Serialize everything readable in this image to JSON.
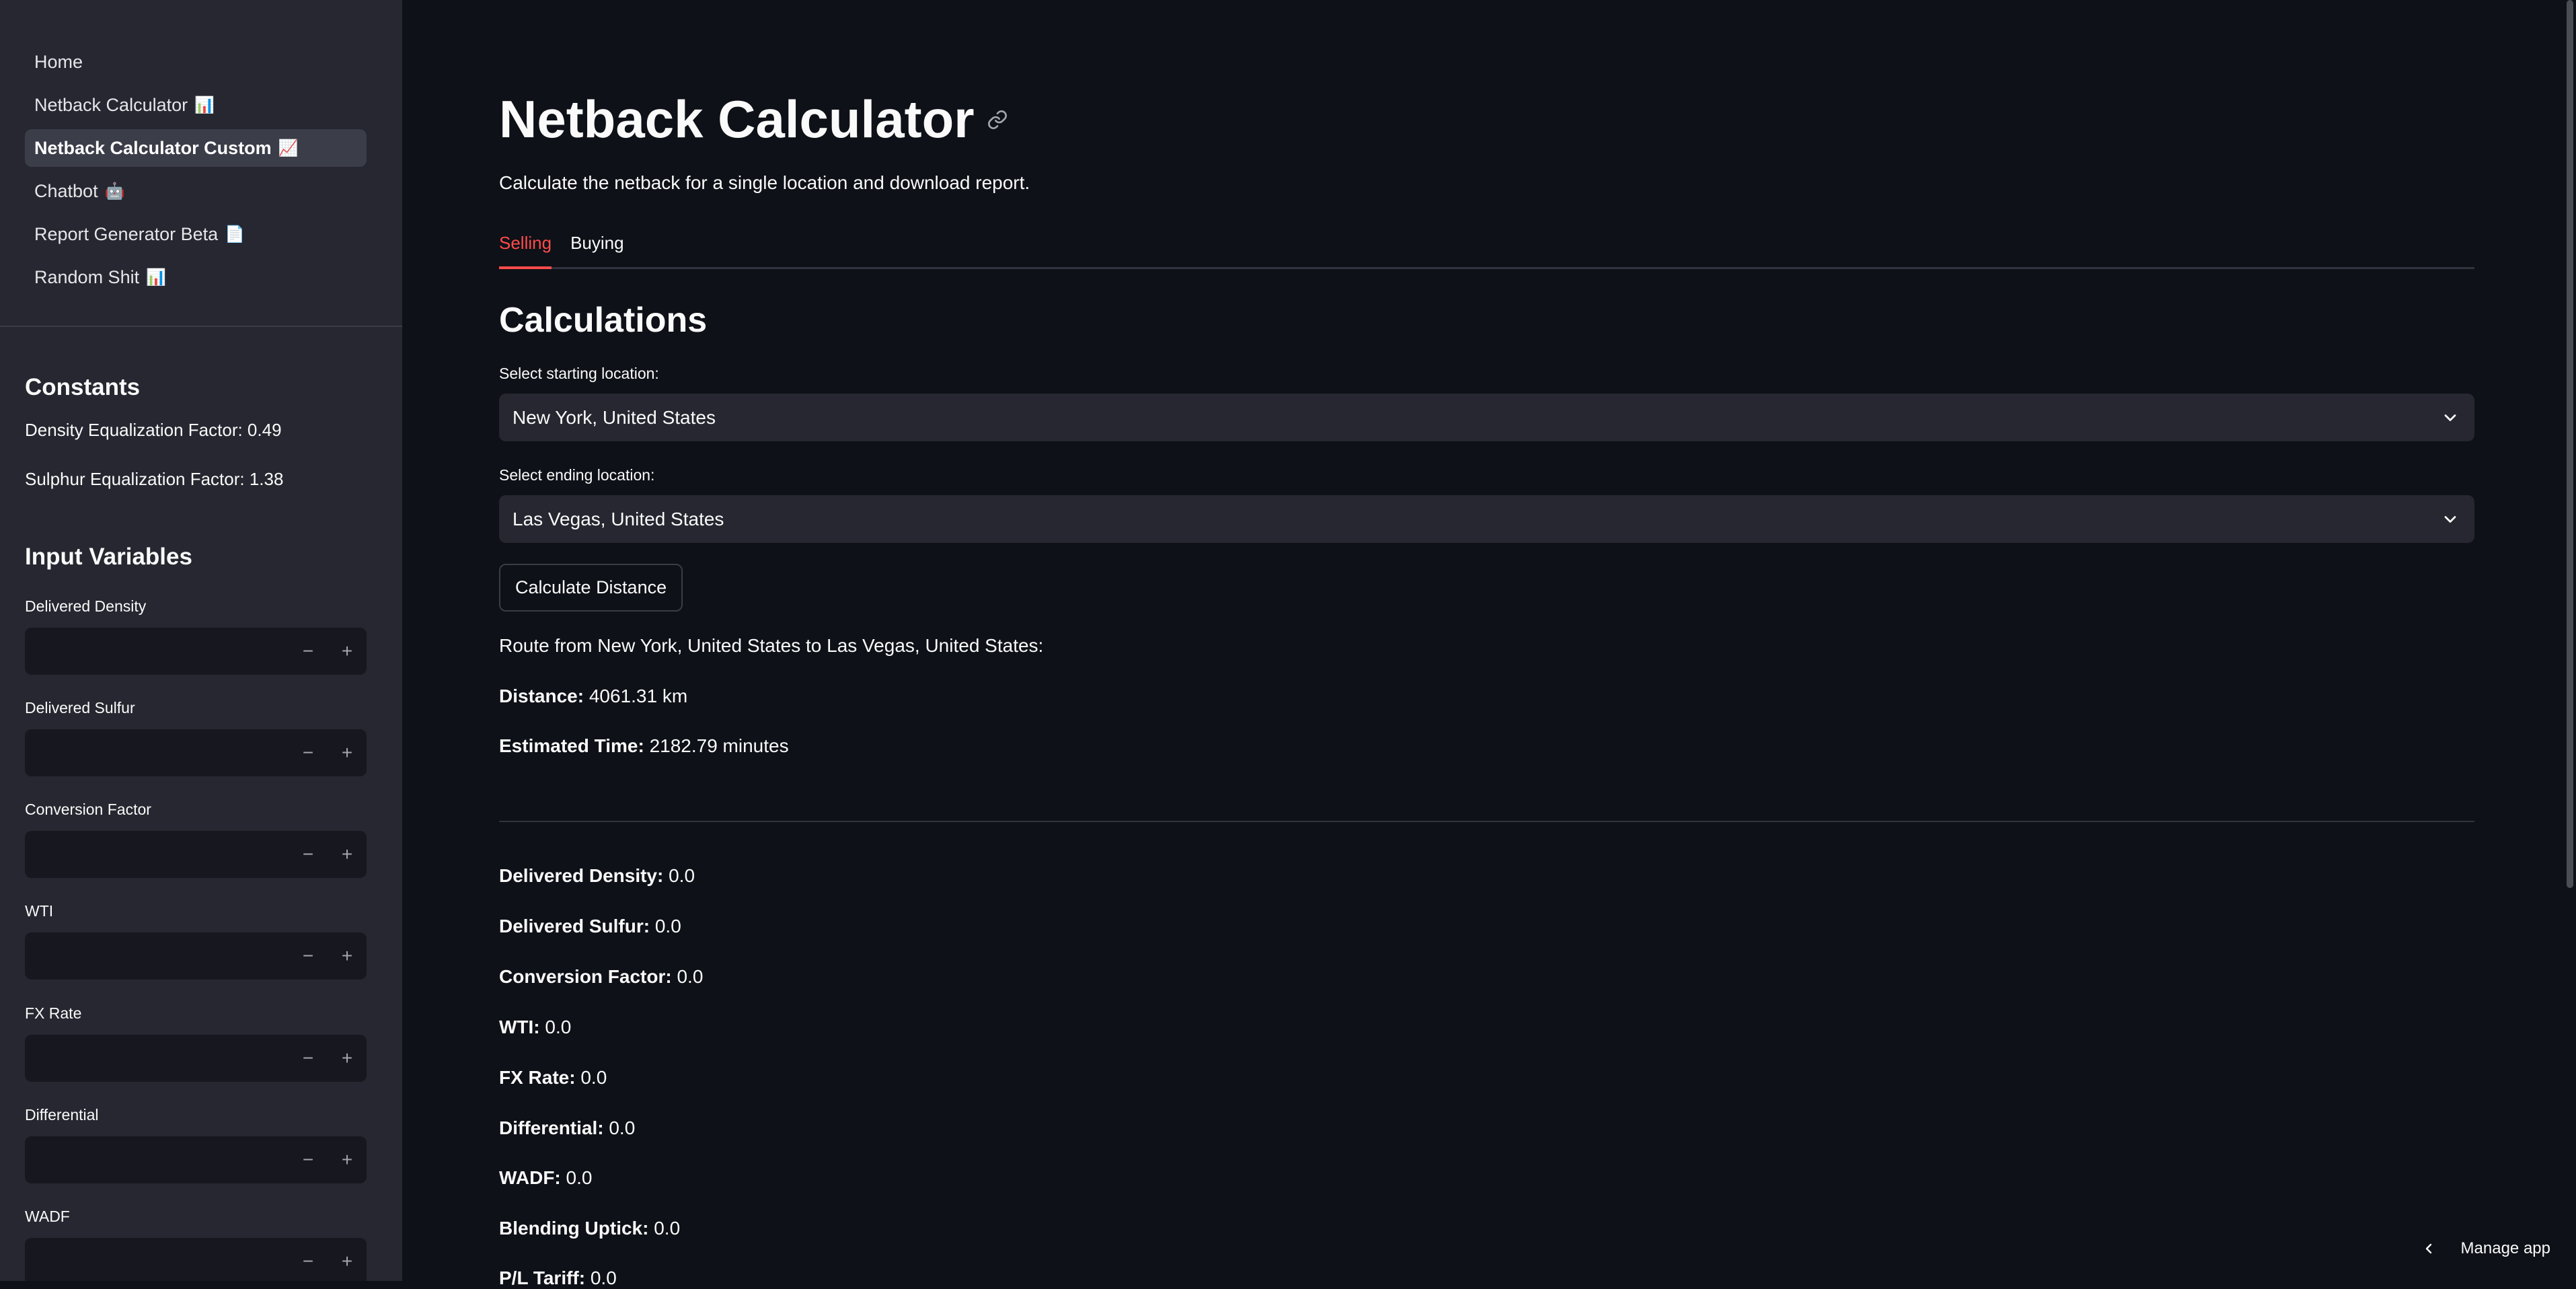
{
  "nav": {
    "items": [
      {
        "label": "Home",
        "emoji": ""
      },
      {
        "label": "Netback Calculator",
        "emoji": "📊"
      },
      {
        "label": "Netback Calculator Custom",
        "emoji": "📈"
      },
      {
        "label": "Chatbot",
        "emoji": "🤖"
      },
      {
        "label": "Report Generator Beta",
        "emoji": "📄"
      },
      {
        "label": "Random Shit",
        "emoji": "📊"
      }
    ],
    "active_index": 2
  },
  "constants": {
    "heading": "Constants",
    "density": "Density Equalization Factor: 0.49",
    "sulphur": "Sulphur Equalization Factor: 1.38"
  },
  "inputs": {
    "heading": "Input Variables",
    "fields": [
      {
        "label": "Delivered Density",
        "value": ""
      },
      {
        "label": "Delivered Sulfur",
        "value": ""
      },
      {
        "label": "Conversion Factor",
        "value": ""
      },
      {
        "label": "WTI",
        "value": ""
      },
      {
        "label": "FX Rate",
        "value": ""
      },
      {
        "label": "Differential",
        "value": ""
      },
      {
        "label": "WADF",
        "value": ""
      }
    ],
    "minus": "−",
    "plus": "+"
  },
  "main": {
    "title": "Netback Calculator",
    "subtitle": "Calculate the netback for a single location and download report.",
    "tabs": [
      {
        "label": "Selling"
      },
      {
        "label": "Buying"
      }
    ],
    "calc_heading": "Calculations",
    "start_label": "Select starting location:",
    "start_value": "New York, United States",
    "end_label": "Select ending location:",
    "end_value": "Las Vegas, United States",
    "button": "Calculate Distance",
    "route": "Route from New York, United States to Las Vegas, United States:",
    "distance_label": "Distance:",
    "distance_value": "4061.31 km",
    "time_label": "Estimated Time:",
    "time_value": "2182.79 minutes",
    "results": [
      {
        "label": "Delivered Density:",
        "value": "0.0"
      },
      {
        "label": "Delivered Sulfur:",
        "value": "0.0"
      },
      {
        "label": "Conversion Factor:",
        "value": "0.0"
      },
      {
        "label": "WTI:",
        "value": "0.0"
      },
      {
        "label": "FX Rate:",
        "value": "0.0"
      },
      {
        "label": "Differential:",
        "value": "0.0"
      },
      {
        "label": "WADF:",
        "value": "0.0"
      },
      {
        "label": "Blending Uptick:",
        "value": "0.0"
      },
      {
        "label": "P/L Tariff:",
        "value": "0.0"
      }
    ]
  },
  "manage_app": "Manage app",
  "colors": {
    "background": "#0e1117",
    "sidebar": "#262730",
    "accent": "#ff4b4b"
  }
}
